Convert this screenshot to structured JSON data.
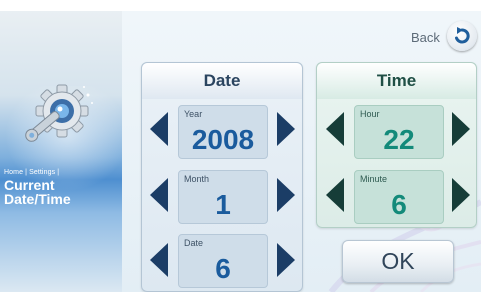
{
  "header": {
    "back_label": "Back"
  },
  "sidebar": {
    "breadcrumb": "Home | Settings |",
    "title_line1": "Current",
    "title_line2": "Date/Time"
  },
  "date_panel": {
    "title": "Date",
    "fields": [
      {
        "label": "Year",
        "value": "2008"
      },
      {
        "label": "Month",
        "value": "1"
      },
      {
        "label": "Date",
        "value": "6"
      }
    ]
  },
  "time_panel": {
    "title": "Time",
    "fields": [
      {
        "label": "Hour",
        "value": "22"
      },
      {
        "label": "Minute",
        "value": "6"
      }
    ]
  },
  "ok_label": "OK",
  "icons": {
    "back": "undo-arrow-icon",
    "settings": "gear-with-wrench-icon",
    "decrement": "triangle-left-icon",
    "increment": "triangle-right-icon"
  },
  "colors": {
    "date_value": "#1a5b9d",
    "time_value": "#138a7a",
    "arrow": "#1b3d66",
    "accent_blue": "#4e8fd0"
  }
}
